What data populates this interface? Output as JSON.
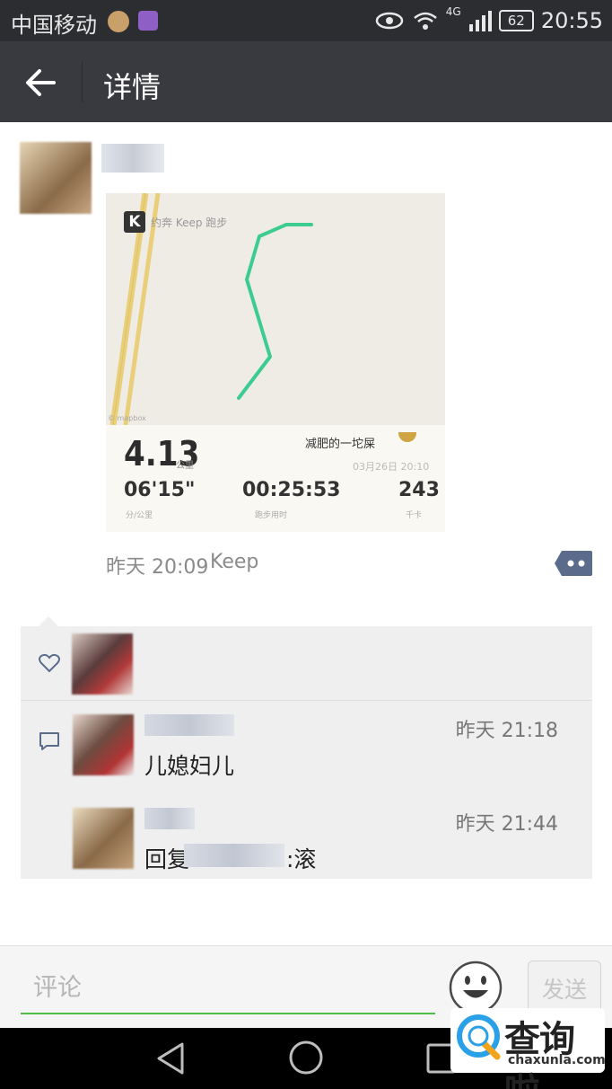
{
  "status_bar": {
    "carrier": "中国移动",
    "network": "4G",
    "battery": "62",
    "time": "20:55"
  },
  "app_bar": {
    "title": "详情"
  },
  "post": {
    "card": {
      "app_tag": "约奔 Keep 跑步",
      "watermark": "© mapbox",
      "distance": "4.13",
      "distance_unit": "公里",
      "signature": "减肥的一坨屎",
      "date": "03月26日 20:10",
      "pace": "06'15\"",
      "pace_label": "分/公里",
      "duration": "00:25:53",
      "duration_label": "跑步用时",
      "calories": "243",
      "calories_label": "千卡"
    },
    "time": "昨天 20:09",
    "source": "Keep"
  },
  "comments": [
    {
      "time": "昨天 21:18",
      "text": "儿媳妇儿"
    },
    {
      "time": "昨天 21:44",
      "reply_prefix": "回复",
      "text": ":滚"
    }
  ],
  "input_bar": {
    "placeholder": "评论",
    "send_label": "发送"
  },
  "badge": {
    "text": "查询啦",
    "url": "chaxunla.com"
  },
  "colors": {
    "route": "#3dcc8f",
    "input_underline": "#4fbf4a",
    "app_bar": "#393a3f"
  }
}
